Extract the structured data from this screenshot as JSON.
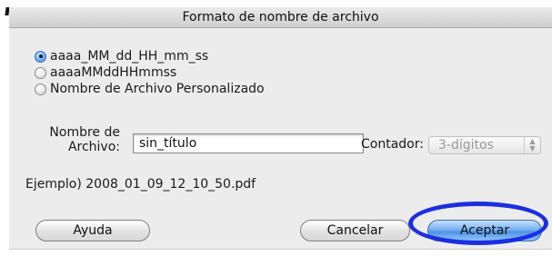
{
  "dialog": {
    "title": "Formato de nombre de archivo"
  },
  "format_options": [
    {
      "label": "aaaa_MM_dd_HH_mm_ss",
      "selected": true
    },
    {
      "label": "aaaaMMddHHmmss",
      "selected": false
    },
    {
      "label": "Nombre de Archivo Personalizado",
      "selected": false
    }
  ],
  "filename": {
    "label_line1": "Nombre de",
    "label_line2": "Archivo:",
    "value": "sin_título"
  },
  "counter": {
    "label": "Contador:",
    "value": "3-dígitos"
  },
  "example": {
    "prefix": "Ejemplo)",
    "value": "2008_01_09_12_10_50.pdf"
  },
  "buttons": {
    "help": "Ayuda",
    "cancel": "Cancelar",
    "ok": "Aceptar"
  },
  "colors": {
    "highlight_ring": "#1c2fe0",
    "default_button": "#4d92e6"
  }
}
